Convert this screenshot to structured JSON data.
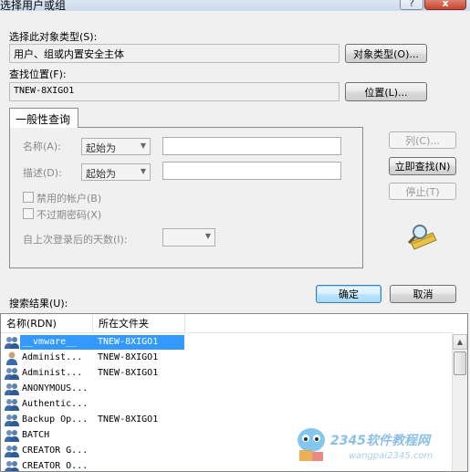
{
  "window": {
    "title": "选择用户或组",
    "close_label": "x",
    "help_label": "?"
  },
  "object_type": {
    "label": "选择此对象类型(S):",
    "value": "用户、组或内置安全主体",
    "button": "对象类型(O)..."
  },
  "location": {
    "label": "查找位置(F):",
    "value": "TNEW-8XIGO1",
    "button": "位置(L)..."
  },
  "query": {
    "tab_label": "一般性查询",
    "name_label": "名称(A):",
    "name_mode": "起始为",
    "desc_label": "描述(D):",
    "desc_mode": "起始为",
    "disabled_accounts": "禁用的帐户(B)",
    "non_expiring_pw": "不过期密码(X)",
    "days_since_logon_label": "自上次登录后的天数(I):",
    "columns_button": "列(C)...",
    "find_now_button": "立即查找(N)",
    "stop_button": "停止(T)"
  },
  "actions": {
    "ok": "确定",
    "cancel": "取消"
  },
  "results": {
    "label": "搜索结果(U):",
    "columns": [
      "名称(RDN)",
      "所在文件夹"
    ],
    "rows": [
      {
        "name": "__vmware__",
        "folder": "TNEW-8XIGO1",
        "icon": "group-icon",
        "selected": true
      },
      {
        "name": "Administ...",
        "folder": "TNEW-8XIGO1",
        "icon": "user-icon"
      },
      {
        "name": "Administ...",
        "folder": "TNEW-8XIGO1",
        "icon": "group-icon"
      },
      {
        "name": "ANONYMOUS...",
        "folder": "",
        "icon": "group-icon"
      },
      {
        "name": "Authentic...",
        "folder": "",
        "icon": "group-icon"
      },
      {
        "name": "Backup Op...",
        "folder": "TNEW-8XIGO1",
        "icon": "group-icon"
      },
      {
        "name": "BATCH",
        "folder": "",
        "icon": "group-icon"
      },
      {
        "name": "CREATOR G...",
        "folder": "",
        "icon": "group-icon"
      },
      {
        "name": "CREATOR O...",
        "folder": "",
        "icon": "group-icon"
      }
    ]
  },
  "watermark": {
    "text": "2345软件教程网",
    "subtext": "wangpai2345.com"
  },
  "colors": {
    "selection": "#3399ff",
    "default_button": "#3c7fb1"
  }
}
